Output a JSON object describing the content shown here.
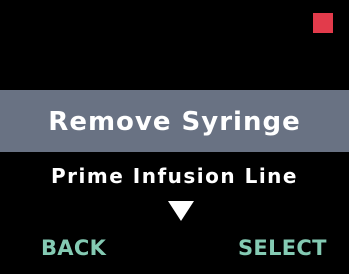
{
  "colors": {
    "background": "#000000",
    "selection_bar": "#697283",
    "text": "#ffffff",
    "softkey": "#84cab3",
    "status_indicator": "#e23b4b"
  },
  "status": {
    "icon": "red-square-indicator"
  },
  "menu": {
    "selected_item": "Remove Syringe",
    "next_item": "Prime Infusion Line",
    "scroll_icon": "down-triangle"
  },
  "softkeys": {
    "left_label": "BACK",
    "right_label": "SELECT"
  }
}
